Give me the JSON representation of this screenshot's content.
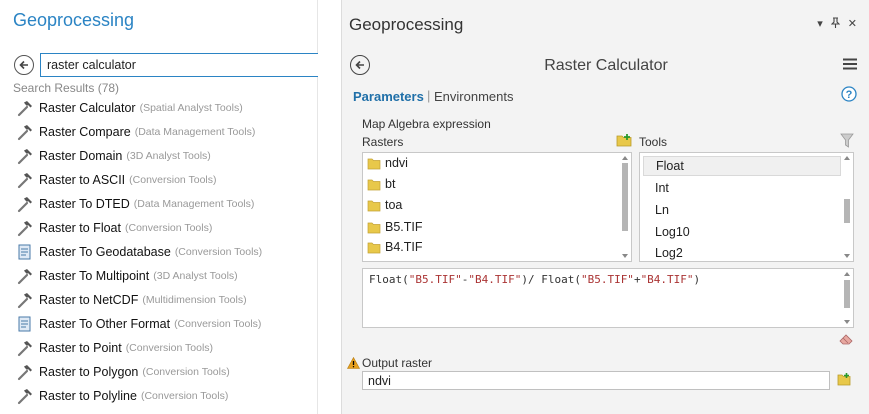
{
  "left_pane": {
    "title": "Geoprocessing",
    "search_value": "raster calculator",
    "results_count": "Search Results (78)",
    "results": [
      {
        "name": "Raster Calculator",
        "toolbox": "(Spatial Analyst Tools)",
        "icon": "hammer-icon"
      },
      {
        "name": "Raster Compare",
        "toolbox": "(Data Management Tools)",
        "icon": "hammer-icon"
      },
      {
        "name": "Raster Domain",
        "toolbox": "(3D Analyst Tools)",
        "icon": "hammer-icon"
      },
      {
        "name": "Raster to ASCII",
        "toolbox": "(Conversion Tools)",
        "icon": "hammer-icon"
      },
      {
        "name": "Raster To DTED",
        "toolbox": "(Data Management Tools)",
        "icon": "hammer-icon"
      },
      {
        "name": "Raster to Float",
        "toolbox": "(Conversion Tools)",
        "icon": "hammer-icon"
      },
      {
        "name": "Raster To Geodatabase",
        "toolbox": "(Conversion Tools)",
        "icon": "script-icon"
      },
      {
        "name": "Raster To Multipoint",
        "toolbox": "(3D Analyst Tools)",
        "icon": "hammer-icon"
      },
      {
        "name": "Raster to NetCDF",
        "toolbox": "(Multidimension Tools)",
        "icon": "hammer-icon"
      },
      {
        "name": "Raster To Other Format",
        "toolbox": "(Conversion Tools)",
        "icon": "script-icon"
      },
      {
        "name": "Raster to Point",
        "toolbox": "(Conversion Tools)",
        "icon": "hammer-icon"
      },
      {
        "name": "Raster to Polygon",
        "toolbox": "(Conversion Tools)",
        "icon": "hammer-icon"
      },
      {
        "name": "Raster to Polyline",
        "toolbox": "(Conversion Tools)",
        "icon": "hammer-icon"
      }
    ]
  },
  "right_pane": {
    "title": "Geoprocessing",
    "tool_title": "Raster Calculator",
    "tabs": {
      "parameters": "Parameters",
      "environments": "Environments"
    },
    "map_algebra_label": "Map Algebra expression",
    "rasters_label": "Rasters",
    "tools_label": "Tools",
    "rasters": [
      "ndvi",
      "bt",
      "toa",
      "B5.TIF",
      "B4.TIF"
    ],
    "tools": [
      "Float",
      "Int",
      "Ln",
      "Log10",
      "Log2"
    ],
    "selected_tool": "Float",
    "expression": {
      "p1": "Float(",
      "q1": "\"B5.TIF\"",
      "p2": "-",
      "q2": "\"B4.TIF\"",
      "p3": ")/ Float(",
      "q3": "\"B5.TIF\"",
      "p4": "+",
      "q4": "\"B4.TIF\"",
      "p5": ")"
    },
    "output_label": "Output raster",
    "output_value": "ndvi"
  },
  "colors": {
    "accent": "#2b84c4",
    "folder": "#e8c84a",
    "warning": "#e6a020"
  }
}
